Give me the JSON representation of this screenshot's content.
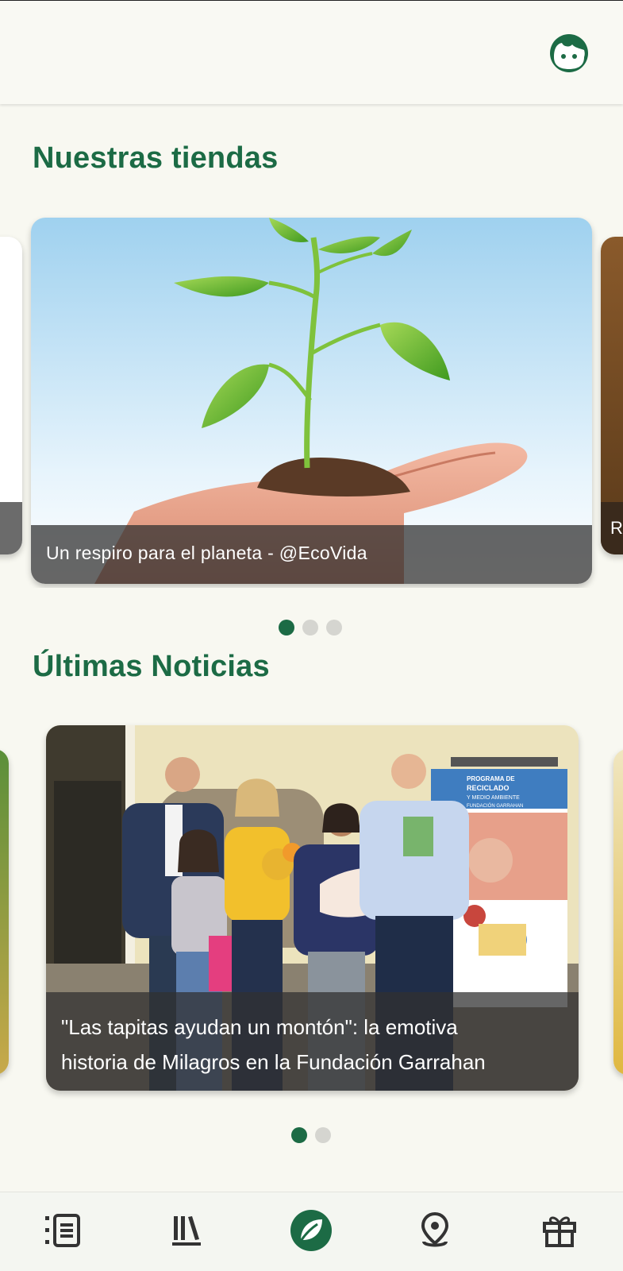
{
  "header": {
    "profile_icon": "face-avatar-icon"
  },
  "stores": {
    "title": "Nuestras tiendas",
    "cards": [
      {
        "caption": "Un respiro para el planeta - @EcoVida"
      },
      {
        "caption": "R"
      }
    ],
    "dots": 3,
    "active_dot": 0
  },
  "news": {
    "title": "Últimas Noticias",
    "cards": [
      {
        "caption_line1": "\"Las tapitas ayudan un montón\": la emotiva",
        "caption_line2": "historia de Milagros en la Fundación Garrahan"
      }
    ],
    "banner_text": {
      "line1": "PROGRAMA DE",
      "line2": "RECICLADO",
      "line3": "Y MEDIO AMBIENTE",
      "line4": "FUNDACIÓN GARRAHAN"
    },
    "dots": 2,
    "active_dot": 0
  },
  "bottom_nav": [
    {
      "icon": "news-list-icon"
    },
    {
      "icon": "library-icon"
    },
    {
      "icon": "leaf-icon",
      "active": true
    },
    {
      "icon": "map-pin-icon"
    },
    {
      "icon": "gift-icon"
    }
  ],
  "colors": {
    "brand": "#1c6b45",
    "background": "#f8f8f1",
    "dot_inactive": "#d5d5d0"
  }
}
